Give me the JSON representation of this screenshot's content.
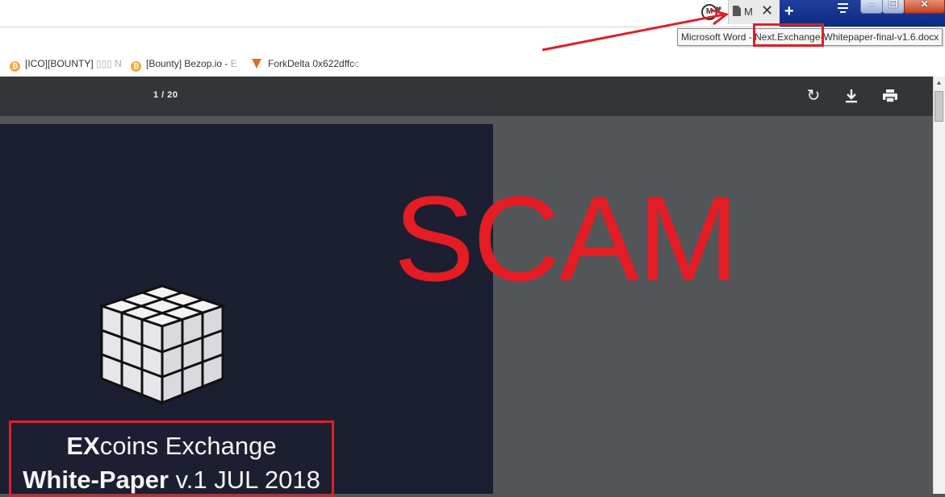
{
  "browser": {
    "tab": {
      "label": "M",
      "close": "✕"
    },
    "newtab": "+",
    "tooltip": "Microsoft Word - Next.Exchange-Whitepaper-final-v1.6.docx",
    "window_buttons": {
      "minimize": "–",
      "restore": "❐",
      "close": "✕"
    }
  },
  "bookmarks": [
    {
      "label": "[ICO][BOUNTY]",
      "fade": " ▯▯▯ N",
      "icon": "bitcoin-icon"
    },
    {
      "label": "[Bounty] Bezop.io - ",
      "fade": "E",
      "icon": "bitcoin-icon"
    },
    {
      "label": "ForkDelta 0x622dffc",
      "fade": "c",
      "icon": "forkdelta-icon"
    }
  ],
  "pdf": {
    "page_indicator": "1  /  20",
    "title_line1_bold": "EX",
    "title_line1_rest": "coins Exchange",
    "title_line2_bold": "White-Paper",
    "title_line2_rest": " v.1 JUL 2018"
  },
  "annotation": {
    "scam_text": "SCAM",
    "color": "#e41c24"
  }
}
